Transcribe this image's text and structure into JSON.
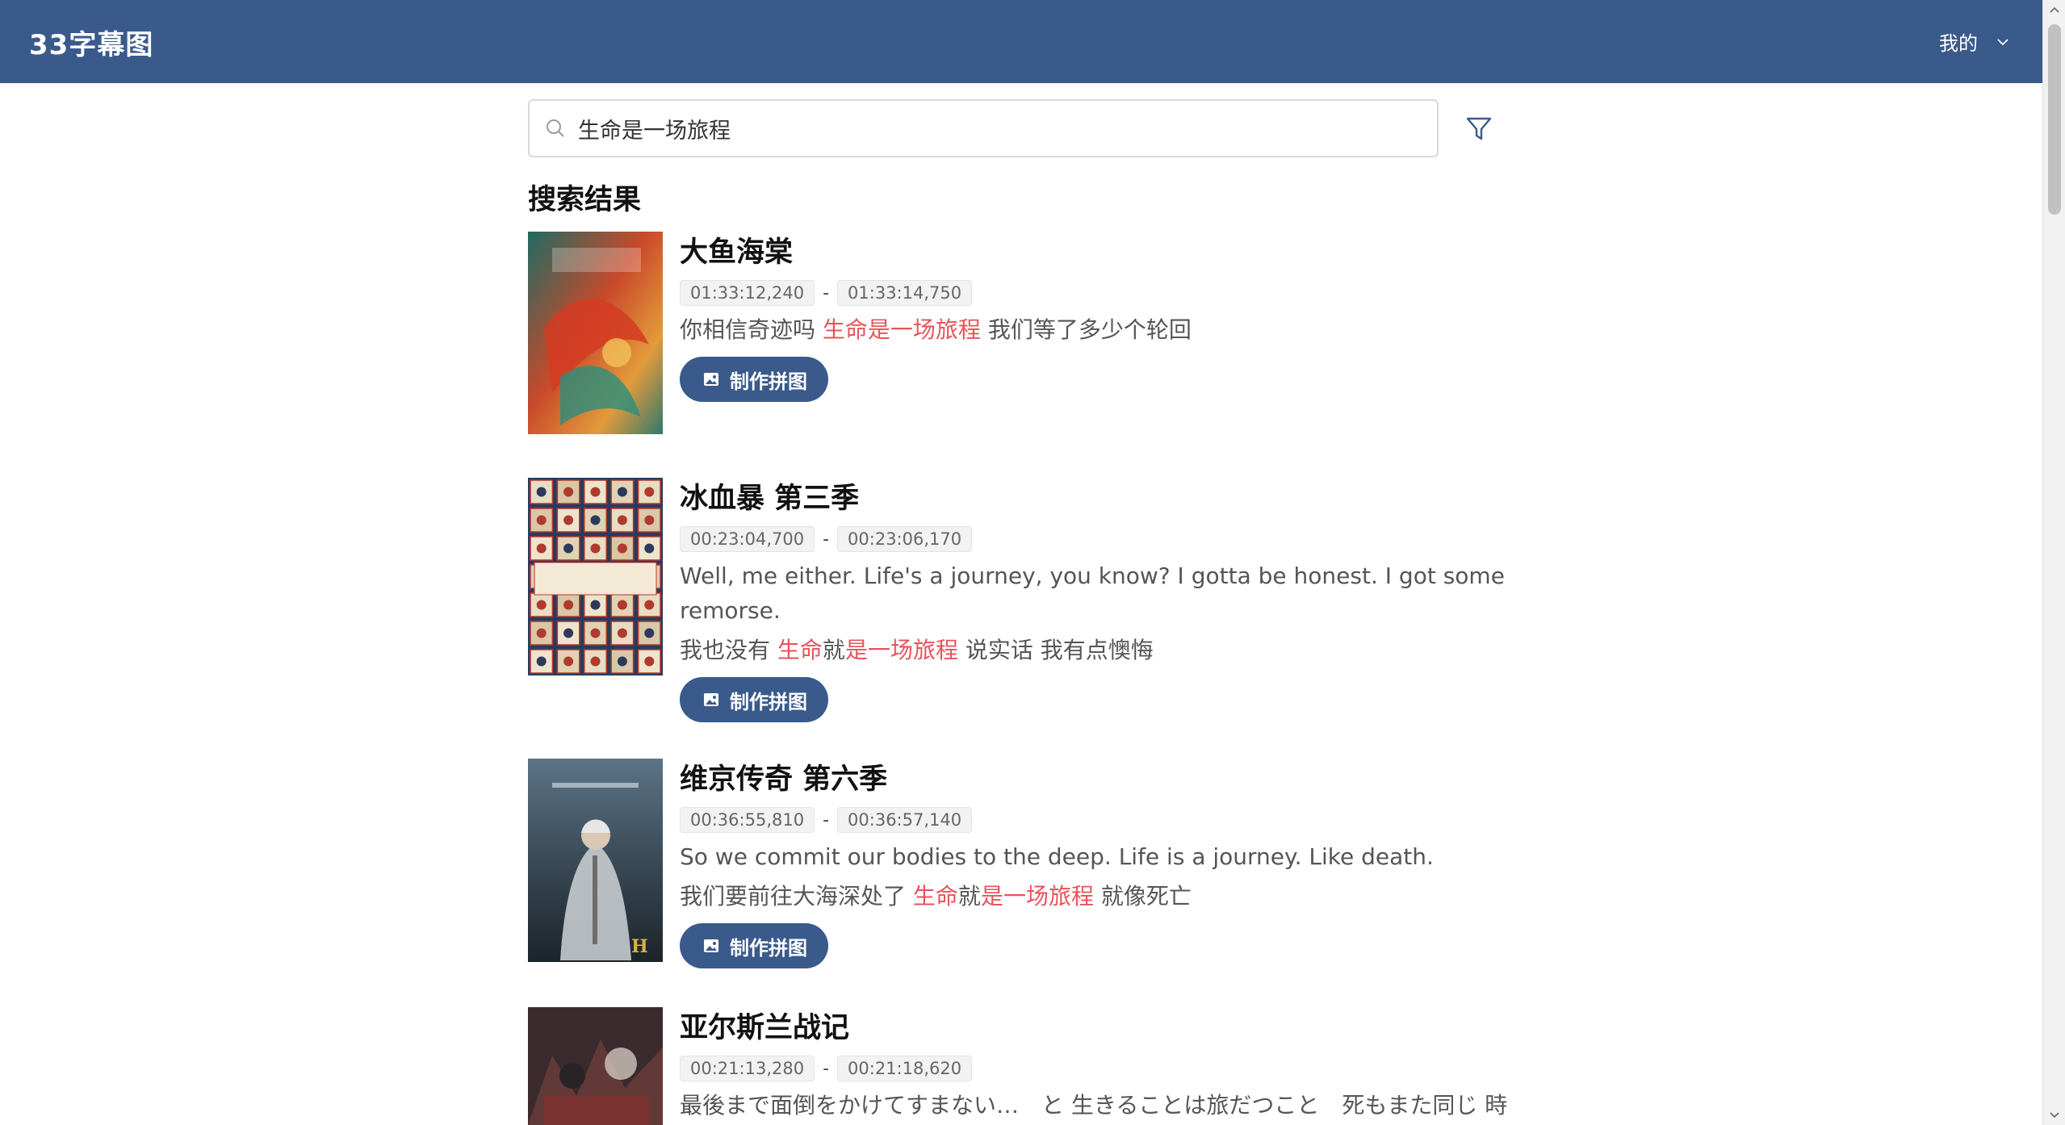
{
  "header": {
    "brand": "33字幕图",
    "user_menu_label": "我的"
  },
  "search": {
    "value": "生命是一场旅程",
    "placeholder": ""
  },
  "results_title": "搜索结果",
  "make_button_label": "制作拼图",
  "results": [
    {
      "title": "大鱼海棠",
      "start": "01:33:12,240",
      "end": "01:33:14,750",
      "lines": [
        [
          {
            "t": "你相信奇迹吗 "
          },
          {
            "t": "生命是一场旅程",
            "hl": true
          },
          {
            "t": " 我们等了多少个轮回"
          }
        ]
      ]
    },
    {
      "title": "冰血暴 第三季",
      "start": "00:23:04,700",
      "end": "00:23:06,170",
      "lines": [
        [
          {
            "t": "Well, me either. Life's a journey, you know? I gotta be honest. I got some remorse."
          }
        ],
        [
          {
            "t": "我也没有 "
          },
          {
            "t": "生命",
            "hl": true
          },
          {
            "t": "就"
          },
          {
            "t": "是一场旅程",
            "hl": true
          },
          {
            "t": " 说实话 我有点懊悔"
          }
        ]
      ]
    },
    {
      "title": "维京传奇 第六季",
      "start": "00:36:55,810",
      "end": "00:36:57,140",
      "lines": [
        [
          {
            "t": "So we commit our bodies to the deep. Life is a journey. Like death."
          }
        ],
        [
          {
            "t": "我们要前往大海深处了 "
          },
          {
            "t": "生命",
            "hl": true
          },
          {
            "t": "就"
          },
          {
            "t": "是一场旅程",
            "hl": true
          },
          {
            "t": " 就像死亡"
          }
        ]
      ]
    },
    {
      "title": "亚尔斯兰战记",
      "start": "00:21:13,280",
      "end": "00:21:18,620",
      "lines": [
        [
          {
            "t": "最後まで面倒をかけてすまない…　と 生きることは旅だつこと　死もまた同じ 時"
          }
        ]
      ]
    }
  ],
  "colors": {
    "primary": "#3a5a8c",
    "highlight": "#e8535a"
  },
  "icons": {
    "search": "magnifier",
    "filter": "funnel",
    "chevron": "chevron-down",
    "image": "picture"
  }
}
